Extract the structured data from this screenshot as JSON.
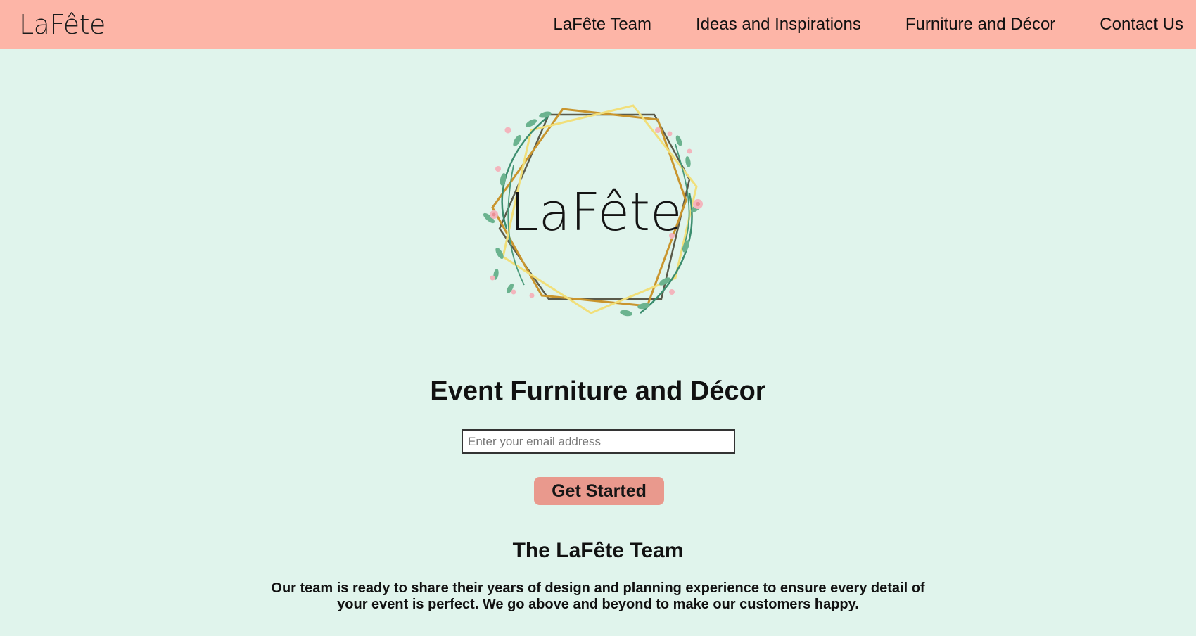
{
  "nav": {
    "logo_text": "LaFête",
    "links": [
      {
        "label": "LaFête Team"
      },
      {
        "label": "Ideas and Inspirations"
      },
      {
        "label": "Furniture and Décor"
      },
      {
        "label": "Contact Us"
      }
    ]
  },
  "hero": {
    "logo_text": "LaFête",
    "logo_icon": "floral-hexagon-wreath-icon",
    "headline": "Event Furniture and Décor",
    "email_placeholder": "Enter your email address",
    "cta_label": "Get Started"
  },
  "team": {
    "heading": "The LaFête Team",
    "text": "Our team is ready to share their years of design and planning experience to ensure every detail of your event is perfect. We go above and beyond to make our customers happy."
  },
  "colors": {
    "navbar": "#fdb5a7",
    "background": "#e0f4ec",
    "button": "#e9998d",
    "frame_gold": "#c9952e",
    "frame_yellow": "#f1df7a",
    "leaf_green": "#3b8d6e",
    "flower_pink": "#f3b5bd"
  }
}
